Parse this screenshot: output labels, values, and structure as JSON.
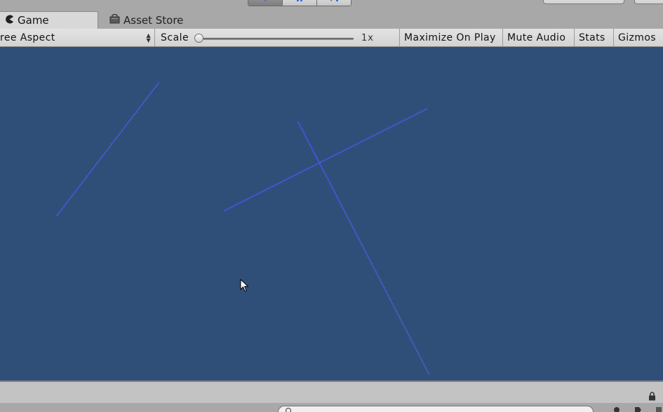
{
  "tabs": [
    {
      "label": "Game",
      "icon": "pacman-icon",
      "active": true
    },
    {
      "label": "Asset Store",
      "icon": "shopping-bag-icon",
      "active": false
    }
  ],
  "toolbar": {
    "aspect_label": "ree Aspect",
    "scale_label": "Scale",
    "scale_value": "1x",
    "scale_slider_level": 0,
    "maximize_label": "Maximize On Play",
    "mute_label": "Mute Audio",
    "stats_label": "Stats",
    "gizmos_label": "Gizmos"
  },
  "play_controls": [
    {
      "name": "play",
      "icon": "play-icon",
      "active": true
    },
    {
      "name": "pause",
      "icon": "pause-icon",
      "active": false
    },
    {
      "name": "step",
      "icon": "step-icon",
      "active": false
    }
  ],
  "colors": {
    "game_background": "#2f4f79",
    "line_color": "#4a5ee8",
    "toolbar_bg": "#dcdcdc"
  },
  "bottom": {
    "lock_icon": "lock-icon",
    "search_placeholder": ""
  }
}
